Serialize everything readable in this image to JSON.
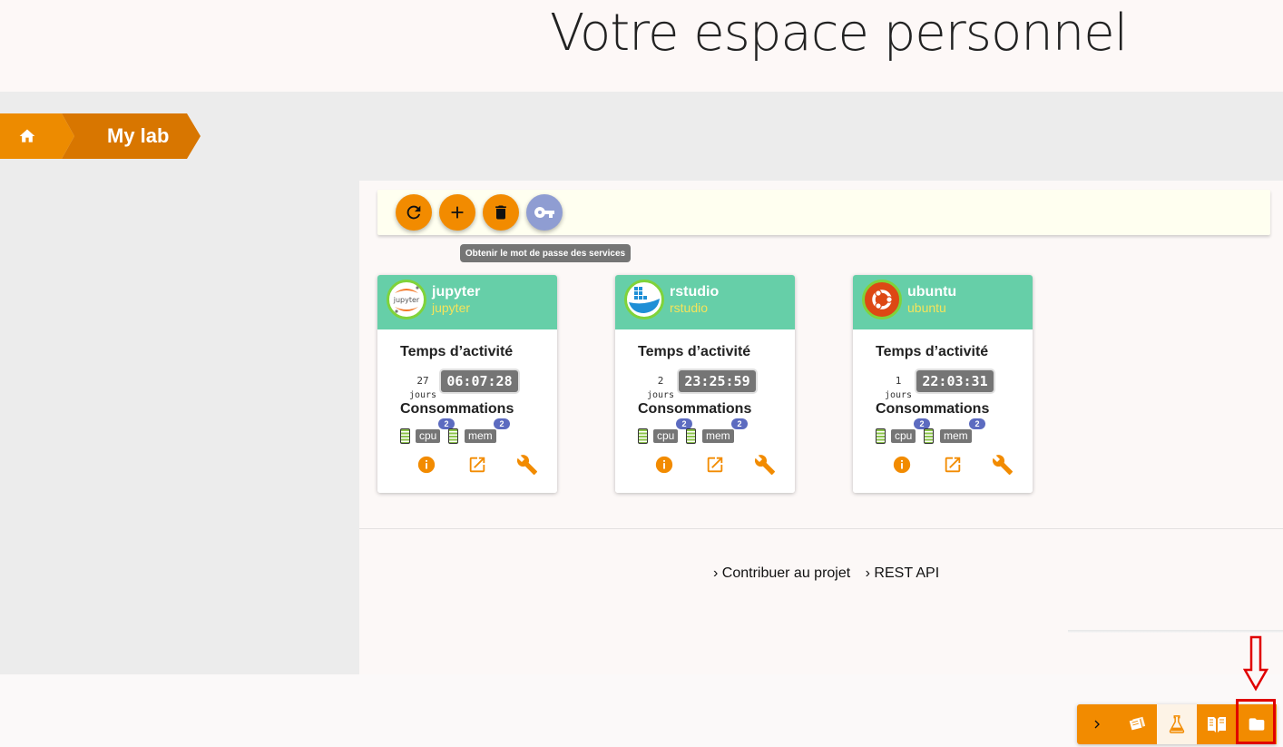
{
  "header": {
    "title": "Votre espace personnel"
  },
  "breadcrumb": {
    "home_icon": "home-icon",
    "current": "My lab"
  },
  "toolbar": {
    "buttons": [
      {
        "name": "refresh",
        "icon": "refresh-icon"
      },
      {
        "name": "add",
        "icon": "plus-icon"
      },
      {
        "name": "delete",
        "icon": "trash-icon"
      },
      {
        "name": "password",
        "icon": "key-icon"
      }
    ],
    "tooltip": "Obtenir le mot de passe des services"
  },
  "cards": [
    {
      "title": "jupyter",
      "subtitle": "jupyter",
      "uptime_label": "Temps d’activité",
      "days": "27",
      "days_label": "jours",
      "clock": "06:07:28",
      "usage_label": "Consommations",
      "cpu_label": "cpu",
      "cpu_count": "2",
      "mem_label": "mem",
      "mem_count": "2",
      "logo": "jupyter-logo"
    },
    {
      "title": "rstudio",
      "subtitle": "rstudio",
      "uptime_label": "Temps d’activité",
      "days": "2",
      "days_label": "jours",
      "clock": "23:25:59",
      "usage_label": "Consommations",
      "cpu_label": "cpu",
      "cpu_count": "2",
      "mem_label": "mem",
      "mem_count": "2",
      "logo": "docker-logo"
    },
    {
      "title": "ubuntu",
      "subtitle": "ubuntu",
      "uptime_label": "Temps d’activité",
      "days": "1",
      "days_label": "jours",
      "clock": "22:03:31",
      "usage_label": "Consommations",
      "cpu_label": "cpu",
      "cpu_count": "2",
      "mem_label": "mem",
      "mem_count": "2",
      "logo": "ubuntu-logo"
    }
  ],
  "footer": {
    "link1": "› Contribuer au projet",
    "link2": "› REST API"
  },
  "dock": {
    "items": [
      "chevron-right-icon",
      "cards-icon",
      "flask-icon",
      "book-icon",
      "folder-icon"
    ],
    "active": "flask-icon",
    "highlighted": "folder-icon"
  },
  "colors": {
    "accent": "#f28b00",
    "card_header": "#66cfa8",
    "key_button": "#8f9dd2",
    "badge": "#5c6bc0",
    "annotation": "#e00000"
  }
}
